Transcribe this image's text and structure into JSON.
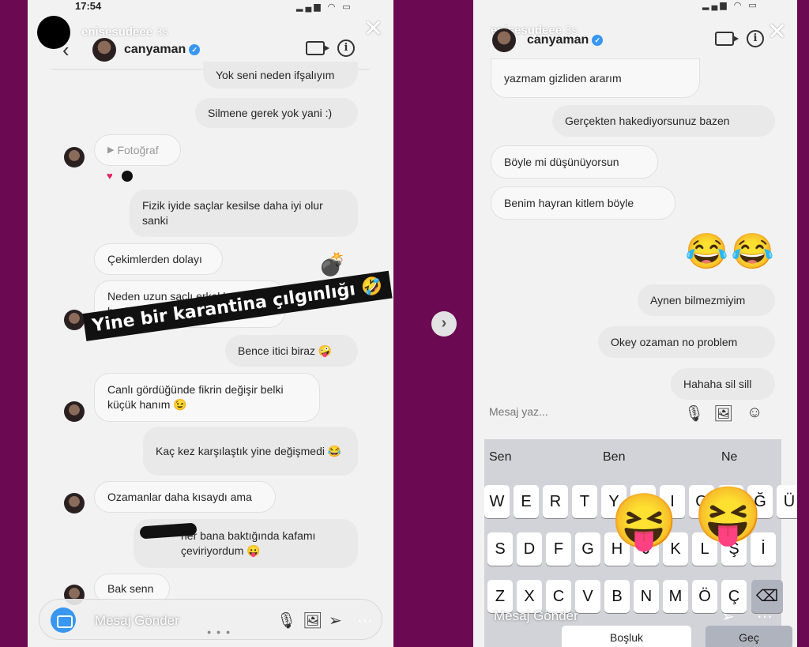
{
  "left": {
    "status_time": "17:54",
    "story_owner": "enisesudeee",
    "story_ago": "3s",
    "chat_name": "canyaman",
    "messages": [
      "Yok seni neden ifşalıyım",
      "Silmene gerek yok yani :)",
      "Fotoğraf",
      "Fizik iyide saçlar kesilse daha iyi olur sanki",
      "Çekimlerden dolayı",
      "Neden uzun saçlı erkeklerden hoşlanmaz mısın 🤔",
      "Bence itici biraz 🤪",
      "Canlı gördüğünde fikrin değişir belki küçük hanım 😉",
      "Kaç kez karşılaştık yine değişmedi 😂",
      "Ozamanlar daha kısaydı ama",
      "her bana baktığında kafamı çeviriyordum 😛",
      "Bak senn"
    ],
    "sticker": "Yine bir karantina çılgınlığı 🤣",
    "composer_label": "Mesaj Gönder"
  },
  "right": {
    "story_owner": "enisesudeee",
    "story_ago": "3s",
    "chat_name": "canyaman",
    "messages": [
      "yazmam gizliden ararım",
      "Gerçekten hakediyorsunuz bazen",
      "Böyle mi düşünüyorsun",
      "Benim hayran kitlem böyle",
      "Aynen bilmezmiyim",
      "Okey ozaman no problem",
      "Hahaha sil sill"
    ],
    "input_placeholder": "Mesaj yaz...",
    "suggestions": [
      "Sen",
      "Ben",
      "Ne"
    ],
    "keys_row1": [
      "W",
      "E",
      "R",
      "T",
      "Y",
      "U",
      "I",
      "O",
      "P",
      "Ğ",
      "Ü"
    ],
    "keys_row2": [
      "S",
      "D",
      "F",
      "G",
      "H",
      "J",
      "K",
      "L",
      "Ş",
      "İ"
    ],
    "keys_row3": [
      "Z",
      "X",
      "C",
      "V",
      "B",
      "N",
      "M",
      "Ö",
      "Ç"
    ],
    "space_label": "Boşluk",
    "go_label": "Geç",
    "composer_label": "Mesaj Gönder"
  },
  "icons": {
    "verified": "verified-badge",
    "video": "video-call-icon",
    "info": "info-icon",
    "close": "close-icon",
    "camera": "camera-icon",
    "mic": "mic-icon",
    "gallery": "gallery-icon",
    "sticker": "sticker-icon",
    "send": "send-icon",
    "more": "more-icon",
    "next": "next-story-icon"
  },
  "colors": {
    "background": "#6b0a52",
    "verified": "#3897f0"
  }
}
